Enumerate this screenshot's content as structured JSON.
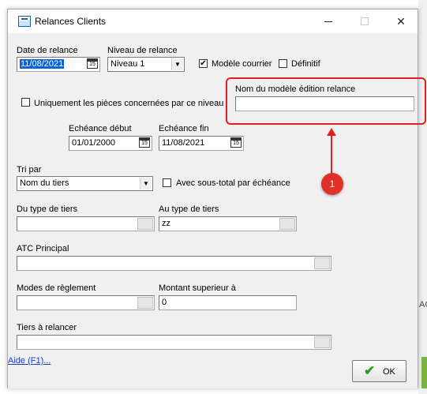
{
  "window": {
    "title": "Relances Clients"
  },
  "icons": {
    "app": "document-icon",
    "minimize": "minimize-icon",
    "maximize": "maximize-icon",
    "close": "close-icon",
    "calendar": "calendar-icon",
    "dropdown": "chevron-down-icon",
    "ok": "checkmark-icon"
  },
  "form": {
    "date_relance_label": "Date de relance",
    "date_relance_value": "11/08/2021",
    "niveau_label": "Niveau de relance",
    "niveau_value": "Niveau 1",
    "modele_courrier_label": "Modèle courrier",
    "modele_courrier_checked": true,
    "definitif_label": "Définitif",
    "definitif_checked": false,
    "uniquement_label": "Uniquement les pièces concernées par ce niveau",
    "uniquement_checked": false,
    "nom_modele_label": "Nom du modèle édition relance",
    "nom_modele_value": "",
    "echeance_debut_label": "Echéance début",
    "echeance_debut_value": "01/01/2000",
    "echeance_fin_label": "Echéance fin",
    "echeance_fin_value": "11/08/2021",
    "calendar_glyph": "15",
    "tri_label": "Tri par",
    "tri_value": "Nom du tiers",
    "sous_total_label": "Avec sous-total par échéance",
    "sous_total_checked": false,
    "du_type_label": "Du type de tiers",
    "du_type_value": "",
    "au_type_label": "Au type de tiers",
    "au_type_value": "zz",
    "atc_label": "ATC Principal",
    "atc_value": "",
    "modes_label": "Modes de règlement",
    "modes_value": "",
    "montant_label": "Montant superieur à",
    "montant_value": "0",
    "tiers_label": "Tiers à relancer",
    "tiers_value": ""
  },
  "annotation": {
    "badge": "1",
    "color": "#e02020"
  },
  "footer": {
    "help": "Aide (F1)...",
    "ok": "OK"
  },
  "background": {
    "partial_text": "AC"
  }
}
